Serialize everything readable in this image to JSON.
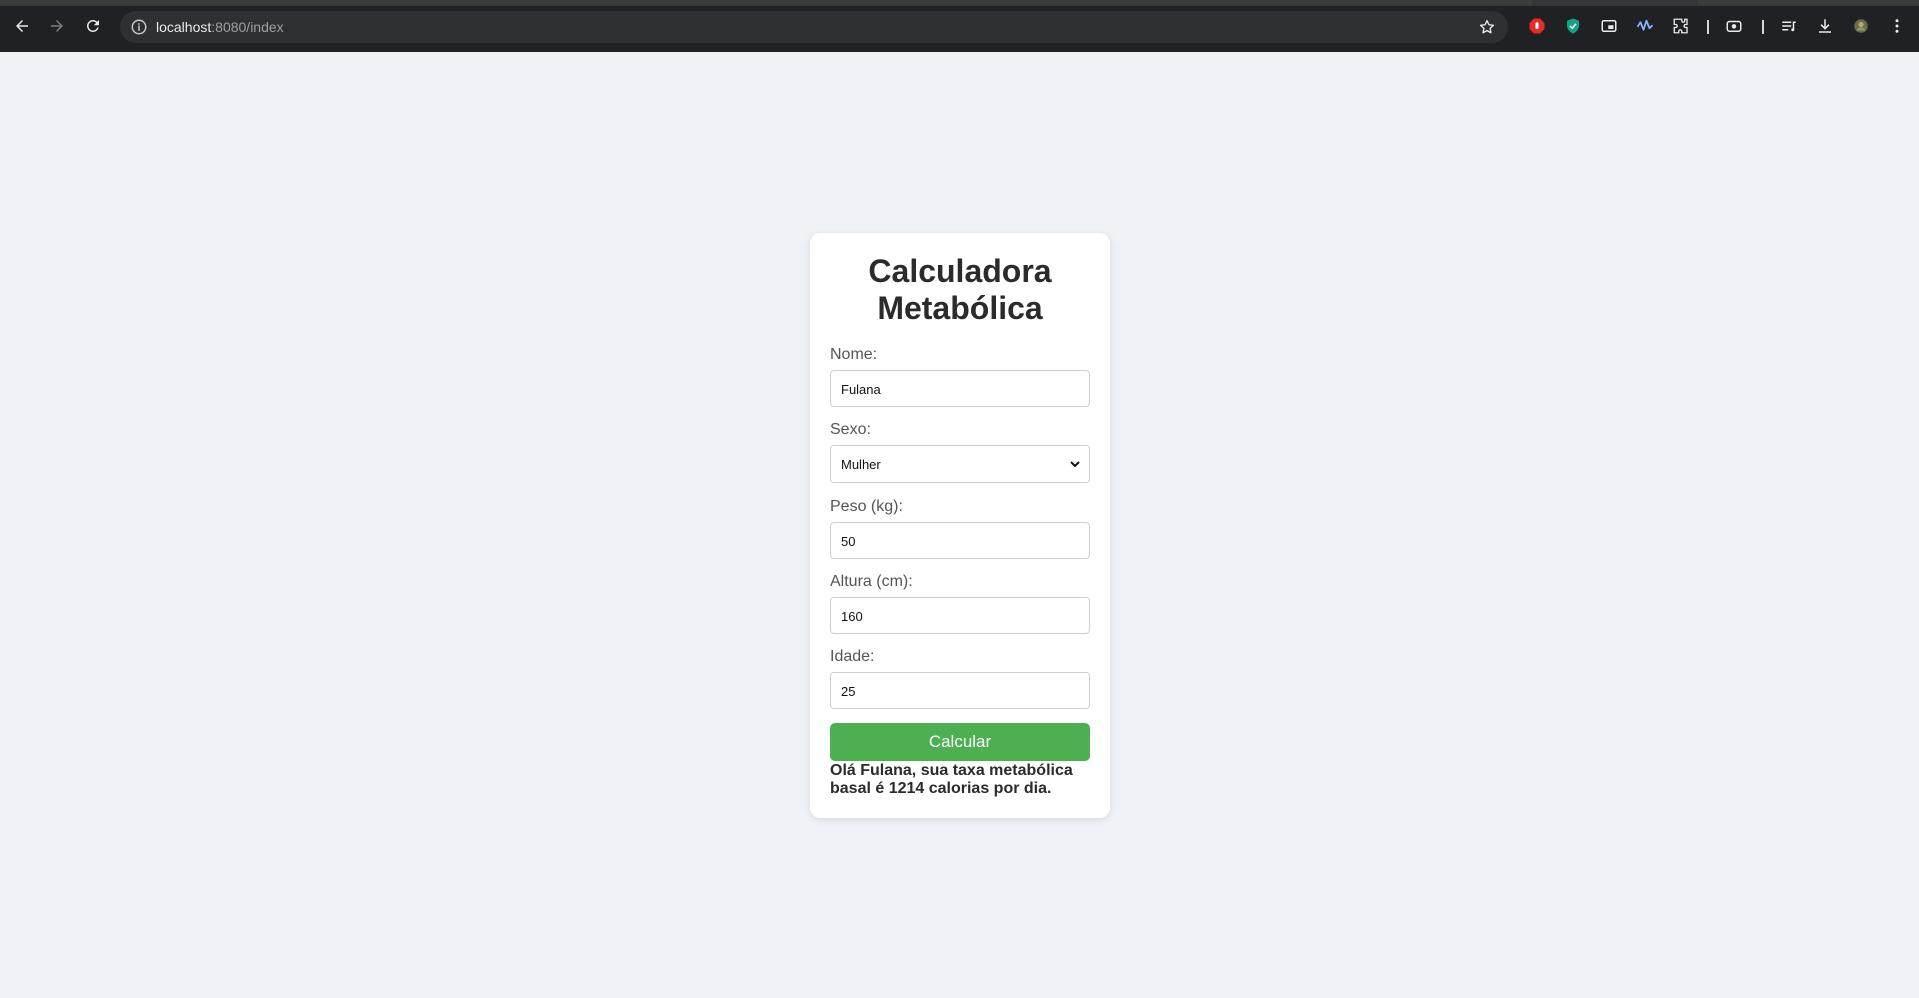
{
  "browser": {
    "url_host": "localhost",
    "url_rest": ":8080/index"
  },
  "form": {
    "title_line1": "Calculadora",
    "title_line2": "Metabólica",
    "nome_label": "Nome:",
    "nome_value": "Fulana",
    "sexo_label": "Sexo:",
    "sexo_value": "Mulher",
    "peso_label": "Peso (kg):",
    "peso_value": "50",
    "altura_label": "Altura (cm):",
    "altura_value": "160",
    "idade_label": "Idade:",
    "idade_value": "25",
    "button_label": "Calcular",
    "result_text": "Olá Fulana, sua taxa metabólica basal é 1214 calorias por dia."
  },
  "colors": {
    "background": "#eff2f6",
    "button": "#4caf50"
  }
}
